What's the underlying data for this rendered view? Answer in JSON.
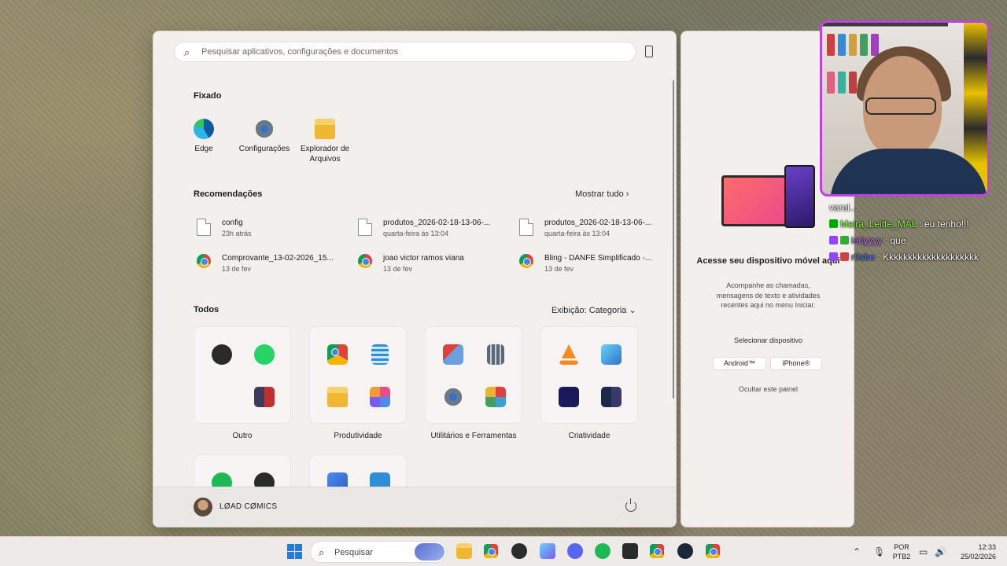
{
  "start_menu": {
    "search_placeholder": "Pesquisar aplicativos, configurações e documentos",
    "pinned": {
      "title": "Fixado",
      "items": [
        {
          "label": "Edge",
          "icon": "edge-icon",
          "color": "#1e8fd8"
        },
        {
          "label": "Configurações",
          "icon": "settings-gear-icon",
          "color": "#5b6b7c"
        },
        {
          "label": "Explorador de\nArquivos",
          "icon": "folder-icon",
          "color": "#f2c24b"
        }
      ]
    },
    "recommendations": {
      "title": "Recomendações",
      "show_all": "Mostrar tudo",
      "items": [
        {
          "name": "config",
          "detail": "23h atrás",
          "icon": "document-icon"
        },
        {
          "name": "produtos_2026-02-18-13-06-...",
          "detail": "quarta-feira às 13:04",
          "icon": "document-icon"
        },
        {
          "name": "produtos_2026-02-18-13-06-...",
          "detail": "quarta-feira às 13:04",
          "icon": "document-icon"
        },
        {
          "name": "Comprovante_13-02-2026_15...",
          "detail": "13 de fev",
          "icon": "chrome-icon"
        },
        {
          "name": "joao victor ramos viana",
          "detail": "13 de fev",
          "icon": "chrome-icon"
        },
        {
          "name": "Bling - DANFE Simplificado -...",
          "detail": "13 de fev",
          "icon": "chrome-icon"
        }
      ]
    },
    "all": {
      "title": "Todos",
      "view": "Exibição: Categoria",
      "groups": [
        {
          "label": "Outro"
        },
        {
          "label": "Produtividade"
        },
        {
          "label": "Utilitários e Ferramentas"
        },
        {
          "label": "Criatividade"
        }
      ]
    },
    "user": {
      "name": "LØAD CØMICS"
    }
  },
  "phone_panel": {
    "title": "Acesse seu dispositivo móvel aqui",
    "description": "Acompanhe as chamadas, mensagens de texto e atividades recentes aqui no menu Iniciar.",
    "select_label": "Selecionar dispositivo",
    "android_btn": "Android™",
    "iphone_btn": "iPhone®",
    "hide_label": "Ocultar este painel"
  },
  "chat": {
    "messages": [
      {
        "user": "",
        "text": "varal..."
      },
      {
        "user": "Maira_Leitte_MAL",
        "text": ": eu tenho!!!"
      },
      {
        "user": "letiyyyy",
        "text": ": que"
      },
      {
        "user": "r0sbo",
        "text": ": Kkkkkkkkkkkkkkkkkkkk"
      }
    ]
  },
  "taskbar": {
    "search_label": "Pesquisar",
    "lang_top": "POR",
    "lang_bottom": "PTB2",
    "time": "12:33",
    "date": "25/02/2026"
  },
  "colors": {
    "accent": "#1f7be0",
    "webcam_border": "#c040e0"
  }
}
